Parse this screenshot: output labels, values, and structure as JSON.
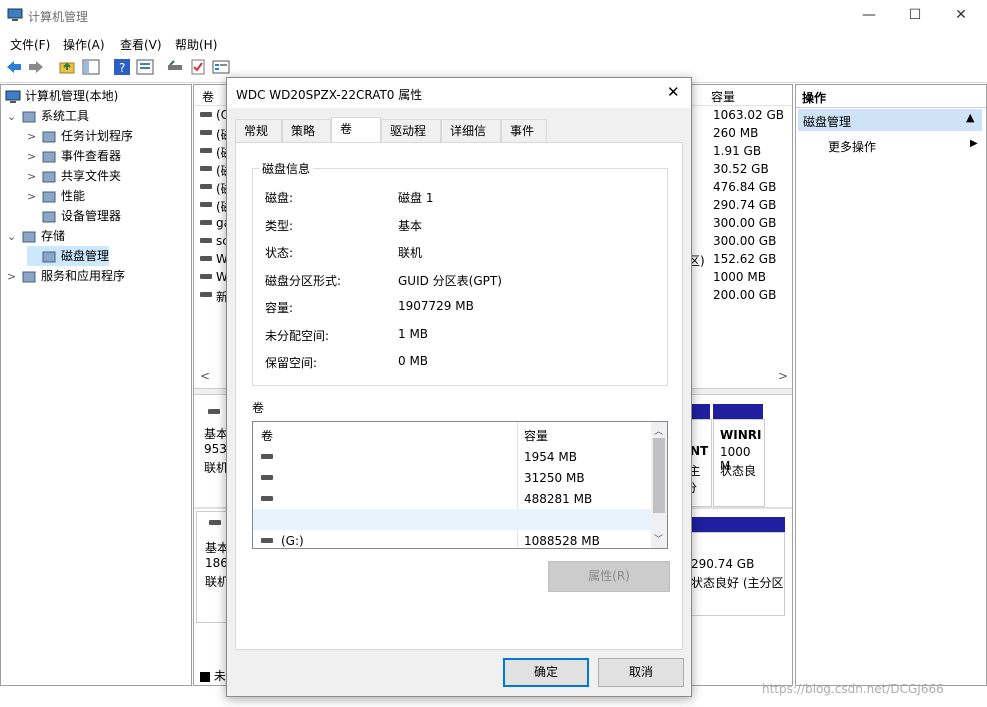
{
  "window": {
    "title": "计算机管理"
  },
  "menu": [
    "文件(F)",
    "操作(A)",
    "查看(V)",
    "帮助(H)"
  ],
  "tree": {
    "root": "计算机管理(本地)",
    "items": [
      {
        "label": "系统工具",
        "level": 1,
        "expander": "⌄"
      },
      {
        "label": "任务计划程序",
        "level": 2,
        "expander": ">"
      },
      {
        "label": "事件查看器",
        "level": 2,
        "expander": ">"
      },
      {
        "label": "共享文件夹",
        "level": 2,
        "expander": ">"
      },
      {
        "label": "性能",
        "level": 2,
        "expander": ">"
      },
      {
        "label": "设备管理器",
        "level": 2,
        "expander": ""
      },
      {
        "label": "存储",
        "level": 1,
        "expander": "⌄"
      },
      {
        "label": "磁盘管理",
        "level": 2,
        "expander": "",
        "selected": true
      },
      {
        "label": "服务和应用程序",
        "level": 1,
        "expander": ">"
      }
    ]
  },
  "center": {
    "col_volume": "卷",
    "col_capacity": "容量",
    "capacities": [
      "1063.02 GB",
      "260 MB",
      "1.91 GB",
      "30.52 GB",
      "476.84 GB",
      "290.74 GB",
      "300.00 GB",
      "300.00 GB",
      "152.62 GB",
      "1000 MB",
      "200.00 GB"
    ],
    "row_prefixes": [
      "(C",
      "(磁",
      "(磁",
      "(磁",
      "(磁",
      "(磁",
      "ga",
      "sc",
      "W",
      "W",
      "新"
    ],
    "suffix_text": "区)",
    "disk0": {
      "kind": "基本",
      "size": "953.",
      "status": "联机"
    },
    "disk1": {
      "kind": "基本",
      "size": "1863",
      "status": "联机"
    },
    "part_nt": "NT",
    "part_nt_sub": "I主分",
    "winre_name": "WINRI",
    "winre_size": "1000 M",
    "winre_status": "状态良",
    "part2_size": "290.74 GB",
    "part2_status": "状态良好 (主分区",
    "legend": "未"
  },
  "actions": {
    "header": "操作",
    "section": "磁盘管理",
    "more": "更多操作"
  },
  "dialog": {
    "title": "WDC WD20SPZX-22CRAT0 属性",
    "tabs": [
      "常规",
      "策略",
      "卷",
      "驱动程序",
      "详细信息",
      "事件"
    ],
    "group_title": "磁盘信息",
    "info": [
      {
        "label": "磁盘:",
        "value": "磁盘 1"
      },
      {
        "label": "类型:",
        "value": "基本"
      },
      {
        "label": "状态:",
        "value": "联机"
      },
      {
        "label": "磁盘分区形式:",
        "value": "GUID 分区表(GPT)"
      },
      {
        "label": "容量:",
        "value": "1907729 MB"
      },
      {
        "label": "未分配空间:",
        "value": "1 MB"
      },
      {
        "label": "保留空间:",
        "value": "0 MB"
      }
    ],
    "volumes_label": "卷",
    "vol_cols": {
      "volume": "卷",
      "capacity": "容量"
    },
    "volumes": [
      {
        "name": "",
        "capacity": "1954 MB"
      },
      {
        "name": "",
        "capacity": "31250 MB"
      },
      {
        "name": "",
        "capacity": "488281 MB"
      },
      {
        "name": "",
        "capacity": ""
      },
      {
        "name": "(G:)",
        "capacity": "1088528 MB"
      }
    ],
    "properties_button": "属性(R)",
    "ok_button": "确定",
    "cancel_button": "取消"
  },
  "watermark": "https://blog.csdn.net/DCGJ666",
  "colors": {
    "accent": "#0078d7",
    "disk_bar": "#1f1fa0",
    "selected_bg": "#cce8ff",
    "action_header_bg": "#cfe3f7"
  }
}
